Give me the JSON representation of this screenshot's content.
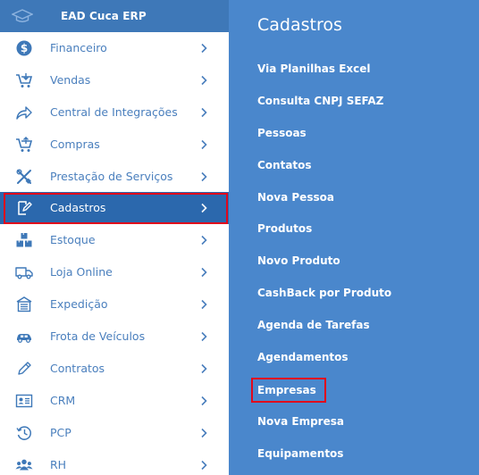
{
  "sidebar": {
    "brand": "EAD Cuca ERP",
    "items": [
      {
        "label": "Financeiro",
        "icon": "dollar-icon"
      },
      {
        "label": "Vendas",
        "icon": "cart-icon"
      },
      {
        "label": "Central de Integrações",
        "icon": "share-icon"
      },
      {
        "label": "Compras",
        "icon": "cart-icon"
      },
      {
        "label": "Prestação de Serviços",
        "icon": "tools-icon"
      },
      {
        "label": "Cadastros",
        "icon": "edit-icon"
      },
      {
        "label": "Estoque",
        "icon": "boxes-icon"
      },
      {
        "label": "Loja Online",
        "icon": "truck-icon"
      },
      {
        "label": "Expedição",
        "icon": "building-icon"
      },
      {
        "label": "Frota de Veículos",
        "icon": "car-icon"
      },
      {
        "label": "Contratos",
        "icon": "pencil-icon"
      },
      {
        "label": "CRM",
        "icon": "id-card-icon"
      },
      {
        "label": "PCP",
        "icon": "history-icon"
      },
      {
        "label": "RH",
        "icon": "users-icon"
      }
    ],
    "active_index": 5
  },
  "panel": {
    "title": "Cadastros",
    "items": [
      "Via Planilhas Excel",
      "Consulta CNPJ SEFAZ",
      "Pessoas",
      "Contatos",
      "Nova Pessoa",
      "Produtos",
      "Novo Produto",
      "CashBack por Produto",
      "Agenda de Tarefas",
      "Agendamentos",
      "Empresas",
      "Nova Empresa",
      "Equipamentos"
    ],
    "highlighted_index": 10
  },
  "colors": {
    "header_bg": "#3e78b8",
    "sidebar_text": "#4a7fbd",
    "active_bg": "#2b68ad",
    "panel_bg": "#4a87cc",
    "highlight_outline": "#e0081c"
  }
}
